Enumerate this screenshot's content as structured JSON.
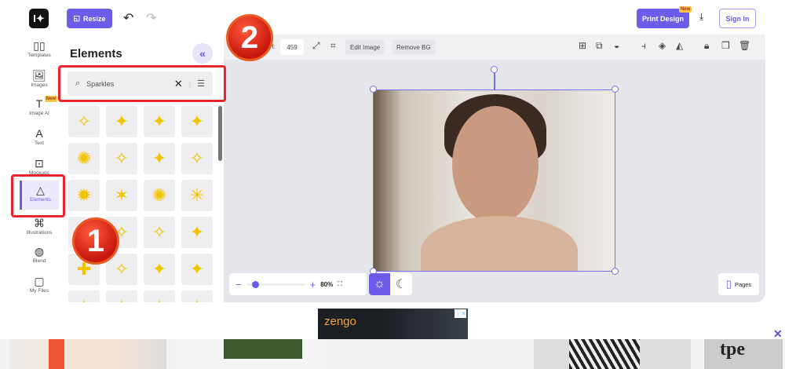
{
  "header": {
    "resize_label": "Resize",
    "print_label": "Print Design",
    "new_badge": "New",
    "sign_in": "Sign In"
  },
  "sidebar": {
    "items": [
      {
        "label": "Templates",
        "icon": "▯▯"
      },
      {
        "label": "Images",
        "icon": "🖼"
      },
      {
        "label": "Image AI",
        "icon": "T",
        "badge": "New"
      },
      {
        "label": "Text",
        "icon": "A"
      },
      {
        "label": "Mockups",
        "icon": "⊡"
      },
      {
        "label": "Elements",
        "icon": "△"
      },
      {
        "label": "Illustrations",
        "icon": "⌘"
      },
      {
        "label": "Blend",
        "icon": "◍"
      },
      {
        "label": "My Files",
        "icon": "▢"
      }
    ]
  },
  "panel": {
    "title": "Elements",
    "search_value": "Sparkles",
    "items": [
      "✧",
      "✦",
      "✦",
      "✦",
      "✺",
      "✧",
      "✦",
      "✧",
      "✹",
      "✶",
      "✺",
      "✳",
      "✦",
      "✧",
      "✧",
      "✦",
      "✚",
      "✧",
      "✦",
      "✦",
      "✦",
      "✦",
      "✦",
      "✦"
    ]
  },
  "toolbar": {
    "h_label": "H:",
    "h_value": "459",
    "edit_image": "Edit Image",
    "remove_bg": "Remove BG"
  },
  "canvas": {
    "zoom_level": "80%",
    "zoom_fraction": 0.1,
    "pages_label": "Pages",
    "theme": "light"
  },
  "ad": {
    "brand": "zengo"
  },
  "annotations": {
    "step1": "1",
    "step2": "2"
  },
  "colors": {
    "accent": "#6c5ce7",
    "annotation": "#e8242e"
  }
}
